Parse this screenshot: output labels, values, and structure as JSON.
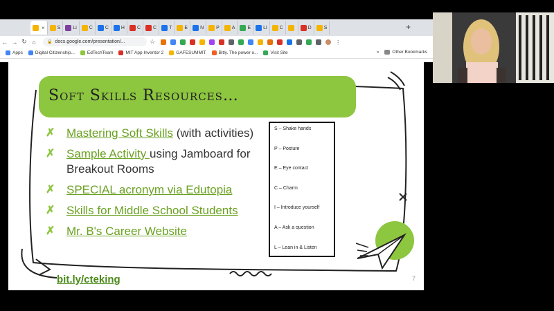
{
  "browser": {
    "tabs": [
      {
        "label": "",
        "color": "#f5b400",
        "active": true
      },
      {
        "label": "S",
        "color": "#f5b400"
      },
      {
        "label": "Li",
        "color": "#7b3f9e"
      },
      {
        "label": "C",
        "color": "#f5b400"
      },
      {
        "label": "C",
        "color": "#1a73e8"
      },
      {
        "label": "H",
        "color": "#1a73e8"
      },
      {
        "label": "C",
        "color": "#d93025"
      },
      {
        "label": "C",
        "color": "#d93025"
      },
      {
        "label": "T",
        "color": "#1a73e8"
      },
      {
        "label": "E",
        "color": "#f5b400"
      },
      {
        "label": "N",
        "color": "#1a73e8"
      },
      {
        "label": "P",
        "color": "#f5b400"
      },
      {
        "label": "A",
        "color": "#f5b400"
      },
      {
        "label": "E",
        "color": "#34a853"
      },
      {
        "label": "Li",
        "color": "#1a73e8"
      },
      {
        "label": "C",
        "color": "#f5b400"
      },
      {
        "label": "",
        "color": "#f5b400"
      },
      {
        "label": "D",
        "color": "#d93025"
      },
      {
        "label": "S",
        "color": "#f5b400"
      }
    ],
    "url": "docs.google.com/presentation/...",
    "bookmarks": [
      {
        "label": "Apps",
        "color": "#4285f4"
      },
      {
        "label": "Digital Citizenship...",
        "color": "#4285f4"
      },
      {
        "label": "EdTechTeam",
        "color": "#8dc63f"
      },
      {
        "label": "MIT App Inventor 2",
        "color": "#d93025"
      },
      {
        "label": "GAFESUMMIT",
        "color": "#f5b400"
      },
      {
        "label": "Bitly. The power o...",
        "color": "#ee6123"
      },
      {
        "label": "Visit Site",
        "color": "#34a853"
      }
    ],
    "other_bookmarks": "Other Bookmarks",
    "more": "»"
  },
  "slide": {
    "title": "Soft Skills Resources…",
    "bullets": [
      {
        "link": "Mastering Soft Skills",
        "text": " (with activities)"
      },
      {
        "link": "Sample Activity ",
        "text": "using Jamboard for Breakout Rooms"
      },
      {
        "link": "SPECIAL acronym via Edutopia",
        "text": ""
      },
      {
        "link": "Skills for Middle School Students",
        "text": ""
      },
      {
        "link": "Mr. B's Career Website",
        "text": ""
      }
    ],
    "acronym": [
      "S – Shake hands",
      "P – Posture",
      "E – Eye contact",
      "C – Charm",
      "I – Introduce yourself",
      "A – Ask a question",
      "L – Lean in & Listen"
    ],
    "short_url": "bit.ly/cteking",
    "page_number": "7",
    "check_glyph": "✗"
  },
  "colors": {
    "accent_green": "#8dc63f",
    "link_green": "#6aa121"
  }
}
